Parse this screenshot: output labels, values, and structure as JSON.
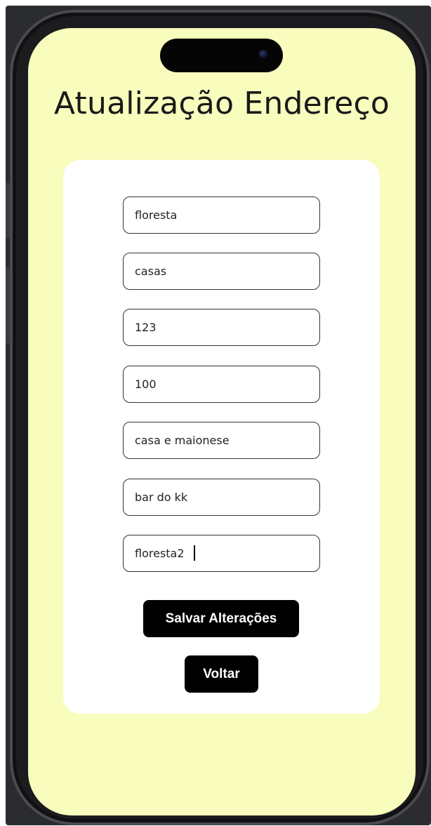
{
  "screen": {
    "title": "Atualização Endereço",
    "background_color": "#f8fcbc"
  },
  "form": {
    "fields": [
      {
        "value": "floresta"
      },
      {
        "value": "casas"
      },
      {
        "value": "123"
      },
      {
        "value": "100"
      },
      {
        "value": "casa e maionese"
      },
      {
        "value": "bar do kk"
      },
      {
        "value": "floresta2",
        "focused": true
      }
    ],
    "save_label": "Salvar Alterações",
    "back_label": "Voltar"
  }
}
